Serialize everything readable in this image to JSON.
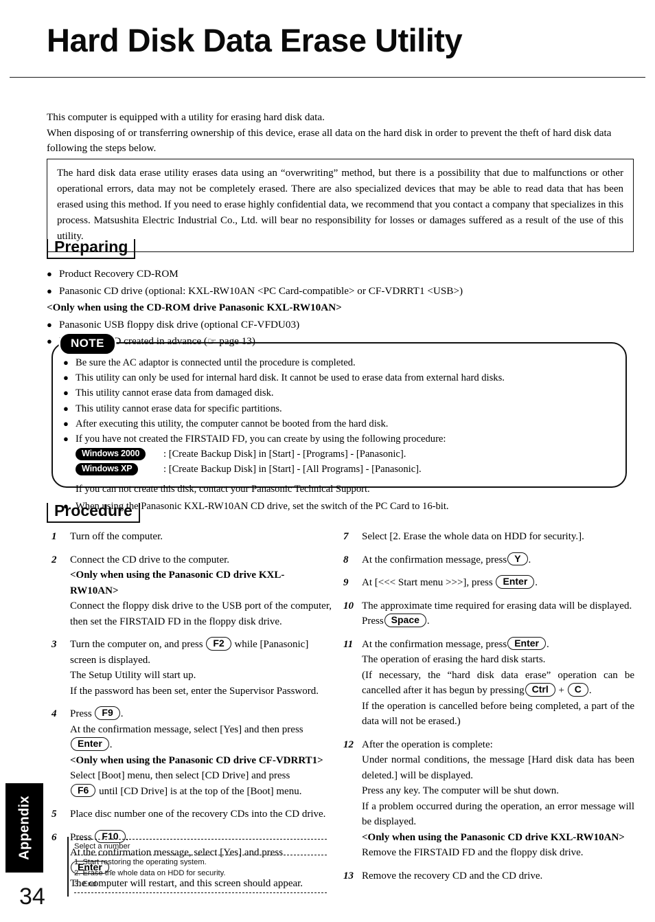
{
  "document": {
    "title": "Hard Disk Data Erase Utility",
    "page_number": "34",
    "tab_label": "Appendix"
  },
  "intro": {
    "line1": "This computer is equipped with a utility for erasing hard disk data.",
    "line2": "When disposing of or transferring ownership of this device, erase all data on the hard disk in order to prevent the theft of hard disk data following the steps below."
  },
  "warning": {
    "text": "The hard disk data erase utility erases data using an “overwriting” method, but there is a possibility that due to malfunctions or other operational errors, data may not be completely erased. There are also specialized devices that may be able to read data that has been erased using this method. If you need to erase highly confidential data, we recommend that you contact a company that specializes in this process. Matsushita Electric Industrial Co., Ltd. will bear no responsibility for losses or damages suffered as a result of the use of this utility."
  },
  "preparing": {
    "heading": "Preparing",
    "item1": "Product Recovery CD-ROM",
    "item2": "Panasonic CD drive (optional:  KXL-RW10AN <PC Card-compatible> or CF-VDRRT1 <USB>)",
    "note_bold": "<Only when using the CD-ROM drive Panasonic KXL-RW10AN>",
    "item3": "Panasonic USB floppy disk drive (optional CF-VFDU03)",
    "item4_pre": "FIRSTAID FD created in advance (",
    "item4_icon": "☞",
    "item4_post": " page 13)"
  },
  "note": {
    "badge": "NOTE",
    "item1": "Be sure the AC adaptor is connected until the procedure is completed.",
    "item2": "This utility can only be used for internal hard disk.  It cannot be used to erase data from external hard disks.",
    "item3": "This utility cannot erase data from damaged disk.",
    "item4": "This utility cannot erase data for specific partitions.",
    "item5": "After executing this utility, the computer cannot be booted from the hard disk.",
    "item6": "If you have not created the FIRSTAID FD, you can create by using the following procedure:",
    "win2000_badge": "Windows 2000",
    "win2000_text": ": [Create Backup Disk] in [Start] - [Programs] - [Panasonic].",
    "winxp_badge": "Windows XP",
    "winxp_text": ": [Create Backup Disk] in [Start] - [All Programs] - [Panasonic].",
    "support_line": "If you can not create this disk, contact your Panasonic Technical Support.",
    "item7": "When using the Panasonic KXL-RW10AN CD drive, set the switch of the PC Card to 16-bit."
  },
  "procedure": {
    "heading": "Procedure",
    "left": {
      "s1_num": "1",
      "s1_line1": "Turn off the computer.",
      "s2_num": "2",
      "s2_line1": "Connect the CD drive to the computer.",
      "s2_bold": "<Only when using the Panasonic CD drive KXL-RW10AN>",
      "s2_line2": "Connect the floppy disk drive to the USB port of the computer, then set the FIRSTAID FD in the floppy disk drive.",
      "s3_num": "3",
      "s3_pre": "Turn the computer on, and press ",
      "s3_key": "F2",
      "s3_post": " while [Panasonic] screen is displayed.",
      "s3_line2": "The Setup Utility will start up.",
      "s3_line3": "If the password has been set, enter the Supervisor Password.",
      "s4_num": "4",
      "s4_pre": "Press ",
      "s4_key": "F9",
      "s4_post": ".",
      "s4_line2": "At the confirmation message, select [Yes] and then press",
      "s4_key2": "Enter",
      "s4_after2": ".",
      "s4_bold": "<Only when using the Panasonic CD drive CF-VDRRT1>",
      "s4_line3": "Select [Boot] menu, then select [CD Drive] and press",
      "s4_key3": "F6",
      "s4_after3": " until [CD Drive] is at the top of the [Boot] menu.",
      "s5_num": "5",
      "s5_line1": "Place disc number one of the recovery CDs into the CD drive.",
      "s6_num": "6",
      "s6_pre": "Press ",
      "s6_key": "F10",
      "s6_post": ".",
      "s6_line2": "At the confirmation message, select [Yes] and press",
      "s6_key2": "Enter",
      "s6_after2": ".",
      "s6_line3": "The computer will restart, and this screen should appear."
    },
    "right": {
      "s7_num": "7",
      "s7_line1": "Select [2. Erase the whole data on HDD for security.].",
      "s8_num": "8",
      "s8_pre": "At the confirmation message, press",
      "s8_key": "Y",
      "s8_post": ".",
      "s9_num": "9",
      "s9_pre": "At [<<< Start menu >>>], press ",
      "s9_key": "Enter",
      "s9_post": ".",
      "s10_num": "10",
      "s10_line1": "The approximate time required for erasing data will be displayed.",
      "s10_pre2": "Press",
      "s10_key": "Space",
      "s10_post2": ".",
      "s11_num": "11",
      "s11_pre": "At the confirmation message, press",
      "s11_key": "Enter",
      "s11_post": ".",
      "s11_line2": "The operation of erasing the hard disk starts.",
      "s11_line3": "(If necessary, the “hard disk data erase” operation can be cancelled after it has begun by pressing",
      "s11_key2": "Ctrl",
      "s11_plus": " + ",
      "s11_key3": "C",
      "s11_after3": ".",
      "s11_line4": "If the operation is cancelled before being completed, a part of the data will not be erased.)",
      "s12_num": "12",
      "s12_line1": "After the operation is complete:",
      "s12_line2": "Under normal conditions, the message [Hard disk data has been deleted.] will be displayed.",
      "s12_line3": "Press any key.  The computer will be shut down.",
      "s12_line4": "If a problem occurred during the operation, an error message will be displayed.",
      "s12_bold": "<Only when using the Panasonic CD drive KXL-RW10AN>",
      "s12_line5": "Remove the FIRSTAID FD and the floppy disk drive.",
      "s13_num": "13",
      "s13_line1": "Remove the recovery CD and the CD drive."
    }
  },
  "screen_mock": {
    "prompt": "Select a number",
    "option1": "1. Start restoring the operating system.",
    "option2": "2. Erase the whole data on HDD for security.",
    "option3": "3. End"
  }
}
